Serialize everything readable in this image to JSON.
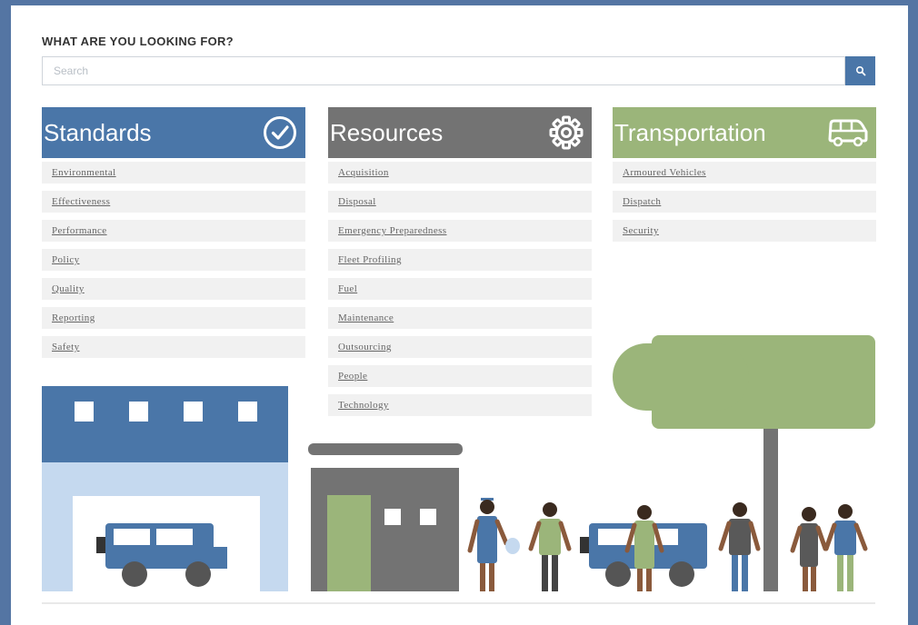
{
  "search": {
    "heading": "WHAT ARE YOU LOOKING FOR?",
    "placeholder": "Search",
    "button_icon": "search-icon"
  },
  "columns": [
    {
      "title": "Standards",
      "icon": "checkmark-circle-icon",
      "color": "#4a76a8",
      "items": [
        "Environmental",
        "Effectiveness",
        "Performance",
        "Policy",
        "Quality",
        "Reporting",
        "Safety"
      ]
    },
    {
      "title": "Resources",
      "icon": "gear-icon",
      "color": "#737373",
      "items": [
        "Acquisition",
        "Disposal",
        "Emergency Preparedness",
        "Fleet Profiling",
        "Fuel",
        "Maintenance",
        "Outsourcing",
        "People",
        "Technology"
      ]
    },
    {
      "title": "Transportation",
      "icon": "van-icon",
      "color": "#9bb57a",
      "items": [
        "Armoured Vehicles",
        "Dispatch",
        "Security"
      ]
    }
  ],
  "colors": {
    "background": "#5475a3",
    "blue": "#4a76a8",
    "light_blue": "#c5d9ef",
    "gray": "#737373",
    "green": "#9bb57a"
  }
}
